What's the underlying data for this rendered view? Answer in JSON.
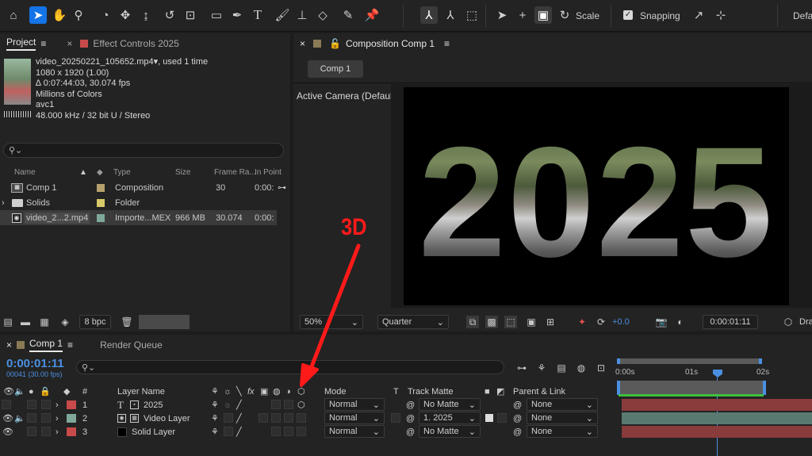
{
  "toolbar": {
    "tools": [
      "home-icon",
      "selection-arrow-icon",
      "hand-icon",
      "zoom-icon",
      "orbit-camera-icon",
      "track-xy-icon",
      "track-z-icon",
      "rotate-icon",
      "pan-behind-icon",
      "rectangle-icon",
      "pen-icon",
      "type-icon",
      "brush-icon",
      "clone-stamp-icon",
      "eraser-icon",
      "roto-brush-icon",
      "puppet-pin-icon"
    ],
    "center_tools": [
      "local-axis-icon",
      "world-axis-icon",
      "view-axis-icon",
      "3d-select-icon",
      "3d-move-icon",
      "3d-scale-icon"
    ],
    "scale_label": "Scale",
    "snapping_label": "Snapping",
    "workspace_label": "Defa"
  },
  "project": {
    "tab_project": "Project",
    "tab_effect_controls": "Effect Controls 2025",
    "footage": {
      "name": "video_20250221_105652.mp4",
      "used": ", used 1 time",
      "dimensions": "1080 x 1920 (1.00)",
      "duration": "∆ 0:07:44:03, 30.074 fps",
      "colors": "Millions of Colors",
      "codec": "avc1",
      "audio": "48.000 kHz / 32 bit U / Stereo"
    },
    "search_placeholder": "",
    "columns": {
      "name": "Name",
      "type": "Type",
      "size": "Size",
      "frame_rate": "Frame Ra...",
      "in_point": "In Point"
    },
    "items": [
      {
        "name": "Comp 1",
        "type": "Composition",
        "size": "",
        "fps": "30",
        "in": "0:00:",
        "color": "#b5a16b"
      },
      {
        "name": "Solids",
        "type": "Folder",
        "size": "",
        "fps": "",
        "in": "",
        "color": "#d8c96a"
      },
      {
        "name": "video_2...2.mp4",
        "type": "Importe...MEX",
        "size": "966 MB",
        "fps": "30.074",
        "in": "0:00:",
        "color": "#7fa89a"
      }
    ],
    "bpc": "8 bpc"
  },
  "composition": {
    "tab_label": "Composition Comp 1",
    "comp_button": "Comp 1",
    "camera_label": "Active Camera (Default)",
    "text": "2025",
    "zoom": "50%",
    "resolution": "Quarter",
    "exposure": "+0.0",
    "timecode": "0:00:01:11",
    "draft": "Dra"
  },
  "annotation": {
    "label": "3D",
    "color": "#ff1a1a"
  },
  "timeline": {
    "tab_comp": "Comp 1",
    "tab_render": "Render Queue",
    "timecode": "0:00:01:11",
    "frame_info": "00041 (30.00 fps)",
    "search_placeholder": "",
    "columns": {
      "num": "#",
      "layer_name": "Layer Name",
      "mode": "Mode",
      "t": "T",
      "track_matte": "Track Matte",
      "parent": "Parent & Link"
    },
    "ruler": [
      "0:00s",
      "01s",
      "02s"
    ],
    "layers": [
      {
        "num": "1",
        "name": "2025",
        "type_icon": "T",
        "color": "#c94a4a",
        "mode": "Normal",
        "matte": "No Matte",
        "parent": "None"
      },
      {
        "num": "2",
        "name": "Video Layer",
        "type_icon": "V",
        "color": "#7fa89a",
        "mode": "Normal",
        "matte": "1. 2025",
        "parent": "None"
      },
      {
        "num": "3",
        "name": "Solid Layer",
        "type_icon": "S",
        "color": "#c94a4a",
        "mode": "Normal",
        "matte": "No Matte",
        "parent": "None"
      }
    ]
  }
}
